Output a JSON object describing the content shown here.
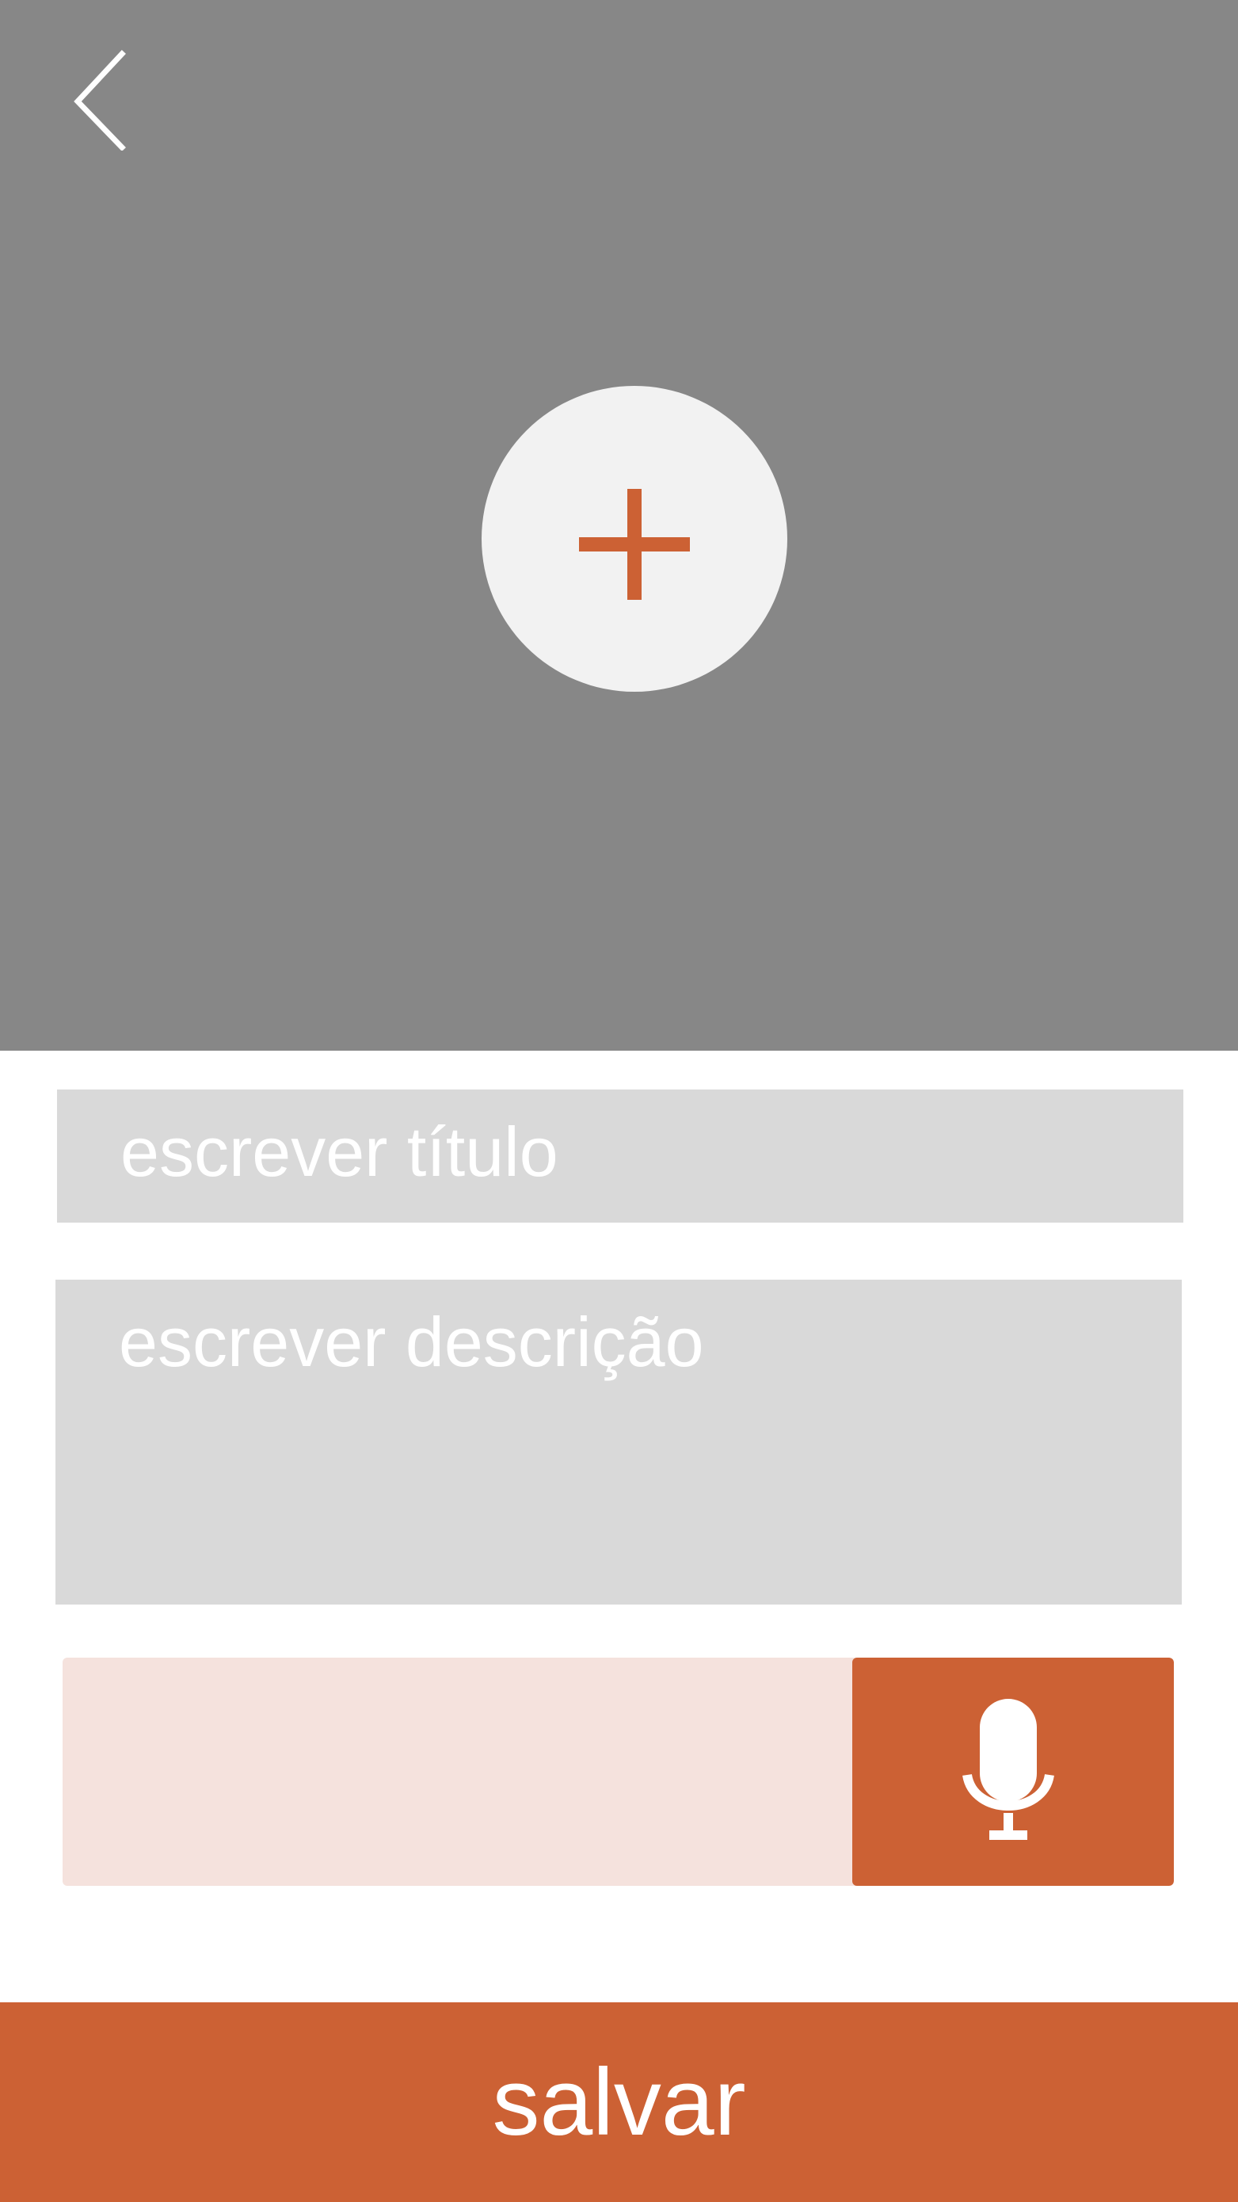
{
  "colors": {
    "hero_background": "#878787",
    "add_circle": "#f2f2f2",
    "accent": "#cc6134",
    "field_background": "#d9d9d9",
    "voice_bar_background": "#f5e2dd"
  },
  "header": {
    "back_icon": "chevron-left-icon"
  },
  "media": {
    "add_icon": "plus-icon"
  },
  "form": {
    "title_placeholder": "escrever título",
    "description_placeholder": "escrever descrição"
  },
  "voice": {
    "mic_icon": "microphone-icon"
  },
  "footer": {
    "save_label": "salvar"
  }
}
